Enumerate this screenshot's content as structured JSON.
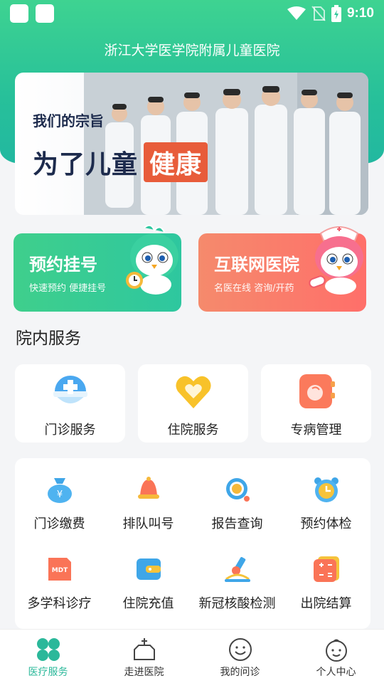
{
  "status_bar": {
    "time": "9:10"
  },
  "header": {
    "title": "浙江大学医学院附属儿童医院"
  },
  "banner": {
    "subtitle": "我们的宗旨",
    "main_text": "为了儿童",
    "highlight": "健康"
  },
  "feature_cards": [
    {
      "title": "预约挂号",
      "subtitle": "快速预约 便捷挂号"
    },
    {
      "title": "互联网医院",
      "subtitle": "名医在线 咨询/开药"
    }
  ],
  "section": {
    "title": "院内服务"
  },
  "services": [
    {
      "label": "门诊服务",
      "icon": "outpatient-icon"
    },
    {
      "label": "住院服务",
      "icon": "heart-icon"
    },
    {
      "label": "专病管理",
      "icon": "disease-management-icon"
    }
  ],
  "grid": [
    {
      "label": "门诊缴费",
      "icon": "money-bag-icon"
    },
    {
      "label": "排队叫号",
      "icon": "bell-icon"
    },
    {
      "label": "报告查询",
      "icon": "search-report-icon"
    },
    {
      "label": "预约体检",
      "icon": "alarm-clock-icon"
    },
    {
      "label": "多学科诊疗",
      "icon": "mdt-icon",
      "badge": "MDT"
    },
    {
      "label": "住院充值",
      "icon": "wallet-icon"
    },
    {
      "label": "新冠核酸检测",
      "icon": "microscope-icon"
    },
    {
      "label": "出院结算",
      "icon": "calculator-icon"
    }
  ],
  "tabbar": [
    {
      "label": "医疗服务",
      "icon": "medical-service-icon",
      "active": true
    },
    {
      "label": "走进医院",
      "icon": "hospital-icon",
      "active": false
    },
    {
      "label": "我的问诊",
      "icon": "smile-icon",
      "active": false
    },
    {
      "label": "个人中心",
      "icon": "child-face-icon",
      "active": false
    }
  ],
  "colors": {
    "primary": "#2bb89a",
    "green": "#3ed391",
    "coral": "#ff6f6a",
    "banner_red": "#e85c3a"
  }
}
